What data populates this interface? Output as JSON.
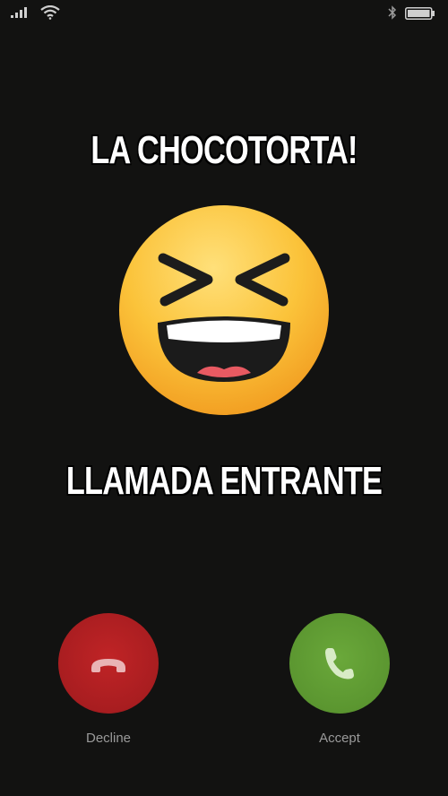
{
  "caller": {
    "name": "LA CHOCOTORTA!",
    "avatar_icon": "grinning-squinting-face-emoji"
  },
  "call": {
    "status": "LLAMADA ENTRANTE"
  },
  "actions": {
    "decline_label": "Decline",
    "accept_label": "Accept"
  },
  "status_bar": {
    "icons": [
      "signal-icon",
      "wifi-icon",
      "bluetooth-icon",
      "battery-icon"
    ]
  },
  "colors": {
    "background": "#121211",
    "decline": "#b01f22",
    "accept": "#5f9b33",
    "emoji_face": "#f8c23a",
    "label_gray": "#9a9a9a"
  }
}
